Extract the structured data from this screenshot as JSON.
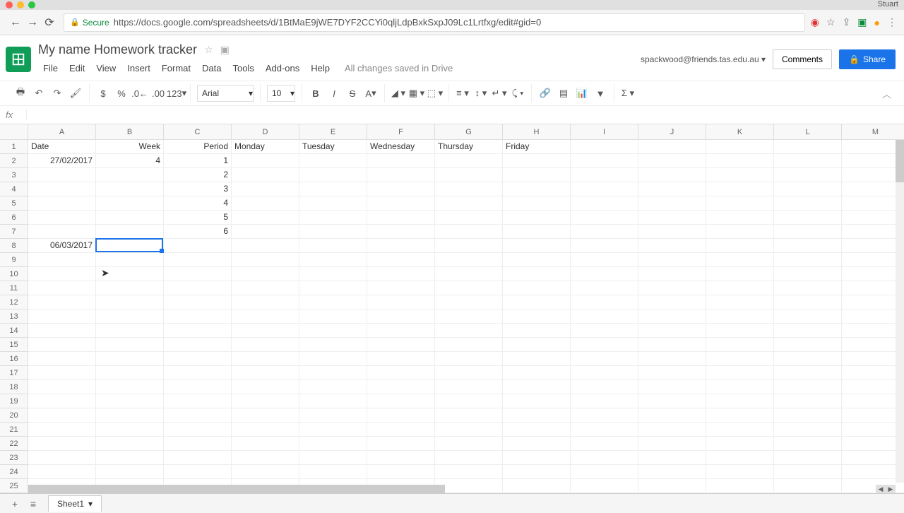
{
  "browser": {
    "user_label": "Stuart",
    "secure_label": "Secure",
    "url": "https://docs.google.com/spreadsheets/d/1BtMaE9jWE7DYF2CCYi0qljLdpBxkSxpJ09Lc1Lrtfxg/edit#gid=0"
  },
  "header": {
    "doc_title": "My name Homework tracker",
    "user_email": "spackwood@friends.tas.edu.au",
    "comments_label": "Comments",
    "share_label": "Share"
  },
  "menu": {
    "file": "File",
    "edit": "Edit",
    "view": "View",
    "insert": "Insert",
    "format": "Format",
    "data": "Data",
    "tools": "Tools",
    "addons": "Add-ons",
    "help": "Help",
    "saved": "All changes saved in Drive"
  },
  "toolbar": {
    "currency": "$",
    "percent": "%",
    "dec_dec": ".0",
    "inc_dec": ".00",
    "numfmt": "123",
    "font": "Arial",
    "size": "10",
    "bold": "B",
    "italic": "I",
    "strike": "S",
    "textcolor": "A"
  },
  "formula": {
    "fx": "fx"
  },
  "grid": {
    "columns": [
      "A",
      "B",
      "C",
      "D",
      "E",
      "F",
      "G",
      "H",
      "I",
      "J",
      "K",
      "L",
      "M"
    ],
    "rows": 25,
    "data": {
      "1": {
        "A": "Date",
        "B": "Week",
        "C": "Period",
        "D": "Monday",
        "E": "Tuesday",
        "F": "Wednesday",
        "G": "Thursday",
        "H": "Friday"
      },
      "2": {
        "A": "27/02/2017",
        "B": "4",
        "C": "1"
      },
      "3": {
        "C": "2"
      },
      "4": {
        "C": "3"
      },
      "5": {
        "C": "4"
      },
      "6": {
        "C": "5"
      },
      "7": {
        "C": "6"
      },
      "8": {
        "A": "06/03/2017"
      }
    },
    "selected": {
      "col": "B",
      "row": 8
    }
  },
  "sheet_tabs": {
    "tab1": "Sheet1"
  }
}
